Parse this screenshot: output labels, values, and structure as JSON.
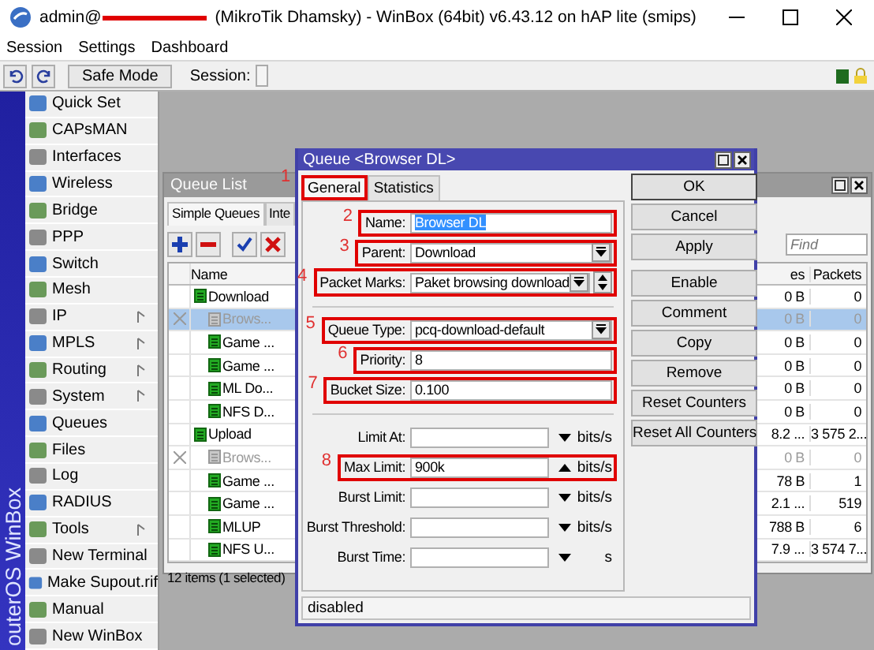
{
  "window": {
    "user": "admin@",
    "host_redacted": true,
    "title": "(MikroTik Dhamsky) - WinBox (64bit) v6.43.12 on hAP lite (smips)"
  },
  "menu": [
    "Session",
    "Settings",
    "Dashboard"
  ],
  "toolbar": {
    "safe_mode": "Safe Mode",
    "session_label": "Session:"
  },
  "side_banner": "outerOS WinBox",
  "sidebar": {
    "items": [
      {
        "label": "Quick Set",
        "submenu": false
      },
      {
        "label": "CAPsMAN",
        "submenu": false
      },
      {
        "label": "Interfaces",
        "submenu": false
      },
      {
        "label": "Wireless",
        "submenu": false
      },
      {
        "label": "Bridge",
        "submenu": false
      },
      {
        "label": "PPP",
        "submenu": false
      },
      {
        "label": "Switch",
        "submenu": false
      },
      {
        "label": "Mesh",
        "submenu": false
      },
      {
        "label": "IP",
        "submenu": true
      },
      {
        "label": "MPLS",
        "submenu": true
      },
      {
        "label": "Routing",
        "submenu": true
      },
      {
        "label": "System",
        "submenu": true
      },
      {
        "label": "Queues",
        "submenu": false
      },
      {
        "label": "Files",
        "submenu": false
      },
      {
        "label": "Log",
        "submenu": false
      },
      {
        "label": "RADIUS",
        "submenu": false
      },
      {
        "label": "Tools",
        "submenu": true
      },
      {
        "label": "New Terminal",
        "submenu": false
      },
      {
        "label": "Make Supout.rif",
        "submenu": false
      },
      {
        "label": "Manual",
        "submenu": false
      },
      {
        "label": "New WinBox",
        "submenu": false
      }
    ]
  },
  "queue_list": {
    "title": "Queue List",
    "tabs": [
      {
        "label": "Simple Queues",
        "selected": true
      },
      {
        "label": "Inte",
        "selected": false
      }
    ],
    "find_placeholder": "Find",
    "columns": [
      "Name",
      "es",
      "Packets"
    ],
    "rows": [
      {
        "name": "Download",
        "enabled": true,
        "selected": false,
        "bytes": "0 B",
        "packets": "0",
        "children": [
          {
            "name": "Brows...",
            "enabled": false,
            "selected": true,
            "bytes": "0 B",
            "packets": "0"
          },
          {
            "name": "Game ...",
            "enabled": true,
            "selected": false,
            "bytes": "0 B",
            "packets": "0"
          },
          {
            "name": "Game ...",
            "enabled": true,
            "selected": false,
            "bytes": "0 B",
            "packets": "0"
          },
          {
            "name": "ML Do...",
            "enabled": true,
            "selected": false,
            "bytes": "0 B",
            "packets": "0"
          },
          {
            "name": "NFS D...",
            "enabled": true,
            "selected": false,
            "bytes": "0 B",
            "packets": "0"
          }
        ]
      },
      {
        "name": "Upload",
        "enabled": true,
        "selected": false,
        "bytes": "8.2 ...",
        "packets": "3 575 2...",
        "children": [
          {
            "name": "Brows...",
            "enabled": false,
            "selected": false,
            "bytes": "0 B",
            "packets": "0"
          },
          {
            "name": "Game ...",
            "enabled": true,
            "selected": false,
            "bytes": "78 B",
            "packets": "1"
          },
          {
            "name": "Game ...",
            "enabled": true,
            "selected": false,
            "bytes": "2.1 ...",
            "packets": "519"
          },
          {
            "name": "MLUP",
            "enabled": true,
            "selected": false,
            "bytes": "788 B",
            "packets": "6"
          },
          {
            "name": "NFS U...",
            "enabled": true,
            "selected": false,
            "bytes": "7.9 ...",
            "packets": "3 574 7..."
          }
        ]
      }
    ],
    "status": "12 items (1 selected)"
  },
  "dialog": {
    "title": "Queue <Browser DL>",
    "tabs": [
      {
        "label": "General",
        "selected": true,
        "highlighted": true,
        "marker": "1"
      },
      {
        "label": "Statistics",
        "selected": false,
        "highlighted": false
      }
    ],
    "groups": [
      [
        {
          "kind": "text",
          "label": "Name:",
          "value": "Browser DL",
          "value_selected": true,
          "highlighted": true,
          "marker": "2"
        },
        {
          "kind": "select",
          "label": "Parent:",
          "value": "Download",
          "value_selected": false,
          "highlighted": true,
          "marker": "3"
        },
        {
          "kind": "multi",
          "label": "Packet Marks:",
          "value": "Paket browsing download",
          "value_selected": false,
          "highlighted": true,
          "marker": "4"
        }
      ],
      [
        {
          "kind": "select",
          "label": "Queue Type:",
          "value": "pcq-download-default",
          "value_selected": false,
          "highlighted": true,
          "marker": "5"
        },
        {
          "kind": "text",
          "label": "Priority:",
          "value": "8",
          "value_selected": false,
          "highlighted": true,
          "marker": "6"
        },
        {
          "kind": "text",
          "label": "Bucket Size:",
          "value": "0.100",
          "value_selected": false,
          "highlighted": true,
          "marker": "7"
        }
      ],
      [
        {
          "kind": "limit",
          "label": "Limit At:",
          "expanded": false,
          "unit": "bits/s",
          "highlighted": false
        },
        {
          "kind": "limit",
          "label": "Max Limit:",
          "value": "900k",
          "value_selected": false,
          "expanded": true,
          "unit": "bits/s",
          "highlighted": true,
          "marker": "8"
        },
        {
          "kind": "limit",
          "label": "Burst Limit:",
          "expanded": false,
          "unit": "bits/s",
          "highlighted": false
        },
        {
          "kind": "limit",
          "label": "Burst Threshold:",
          "expanded": false,
          "unit": "bits/s",
          "highlighted": false
        },
        {
          "kind": "limit",
          "label": "Burst Time:",
          "expanded": false,
          "unit": "s",
          "highlighted": false
        }
      ]
    ],
    "buttons": [
      [
        {
          "label": "OK",
          "default": true
        },
        {
          "label": "Cancel",
          "default": false
        },
        {
          "label": "Apply",
          "default": false
        }
      ],
      [
        {
          "label": "Enable",
          "default": false
        },
        {
          "label": "Comment",
          "default": false
        },
        {
          "label": "Copy",
          "default": false
        },
        {
          "label": "Remove",
          "default": false
        },
        {
          "label": "Reset Counters",
          "default": false
        },
        {
          "label": "Reset All Counters",
          "default": false
        }
      ]
    ],
    "status": "disabled"
  }
}
